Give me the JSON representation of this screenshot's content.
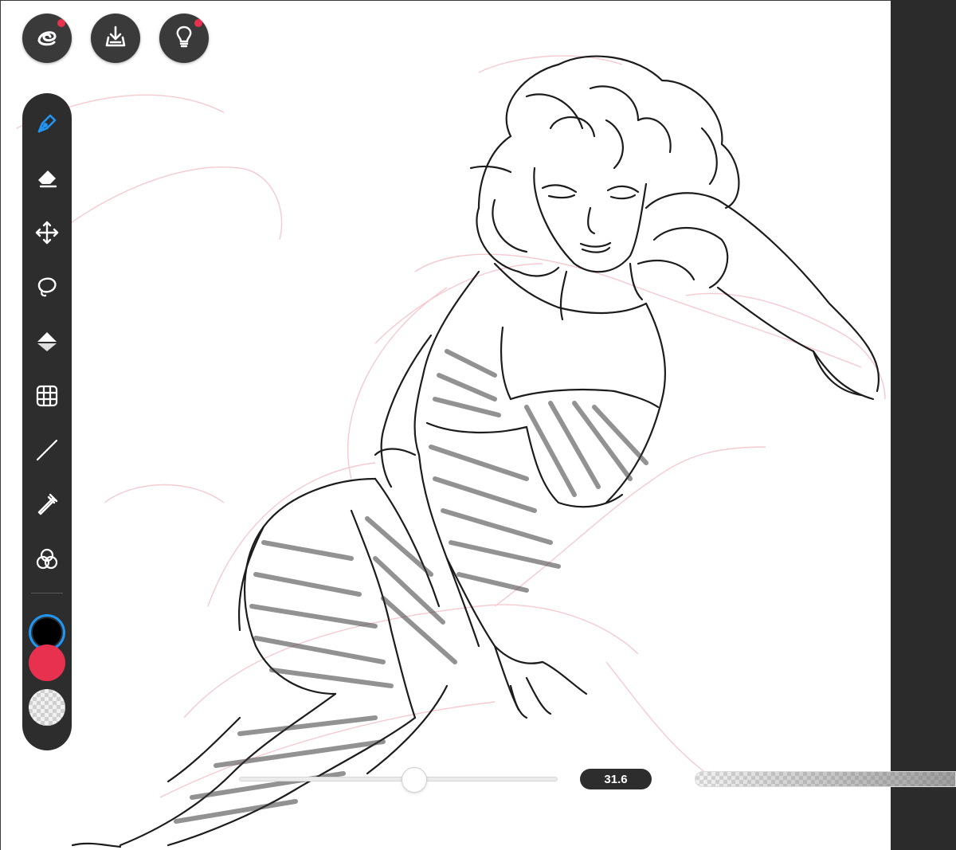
{
  "app": {
    "top_buttons": [
      {
        "name": "brush-library-icon",
        "badge": true
      },
      {
        "name": "import-export-icon",
        "badge": false
      },
      {
        "name": "tips-bulb-icon",
        "badge": true
      }
    ]
  },
  "tools": [
    {
      "name": "pen-tool",
      "icon": "pen-nib-icon",
      "active": true
    },
    {
      "name": "eraser-tool",
      "icon": "eraser-icon",
      "active": false
    },
    {
      "name": "move-tool",
      "icon": "move-arrows-icon",
      "active": false
    },
    {
      "name": "lasso-tool",
      "icon": "lasso-icon",
      "active": false
    },
    {
      "name": "fill-tool",
      "icon": "paint-bucket-icon",
      "active": false
    },
    {
      "name": "perspective-grid-tool",
      "icon": "grid-icon",
      "active": false
    },
    {
      "name": "line-tool",
      "icon": "line-icon",
      "active": false
    },
    {
      "name": "eyedropper-tool",
      "icon": "eyedropper-icon",
      "active": false
    },
    {
      "name": "blend-tool",
      "icon": "color-circles-icon",
      "active": false
    }
  ],
  "colors": {
    "primary": "#000000",
    "secondary": "#e8314f",
    "active_ring": "#1e88e5",
    "accent": "#2196f3",
    "panel": "#2d2d2d"
  },
  "brush": {
    "size_label": "31.6",
    "size_fraction": 0.55,
    "opacity_fraction": 1.0
  }
}
